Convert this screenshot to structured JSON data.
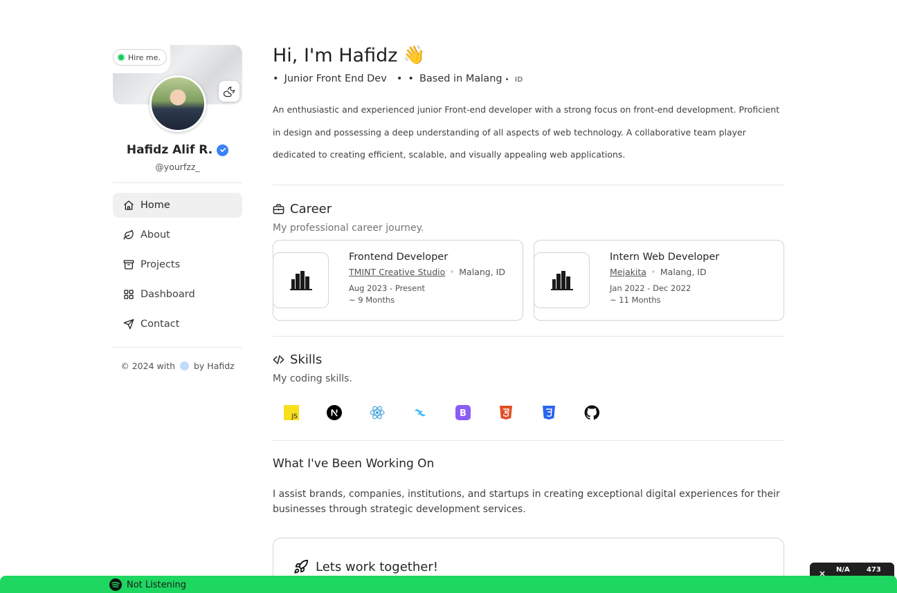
{
  "sidebar": {
    "hire_label": "Hire me.",
    "name": "Hafidz Alif R.",
    "handle": "@yourfzz_",
    "nav": [
      {
        "label": "Home",
        "icon": "home-icon",
        "active": true
      },
      {
        "label": "About",
        "icon": "leaf-icon",
        "active": false
      },
      {
        "label": "Projects",
        "icon": "archive-icon",
        "active": false
      },
      {
        "label": "Dashboard",
        "icon": "dashboard-icon",
        "active": false
      },
      {
        "label": "Contact",
        "icon": "send-icon",
        "active": false
      }
    ],
    "credit_prefix": "© 2024 with",
    "credit_suffix": "by Hafidz"
  },
  "hero": {
    "greeting": "Hi, I'm Hafidz",
    "wave_emoji": "👋",
    "role": "Junior Front End Dev",
    "location": "Based in Malang",
    "location_tag": "ID",
    "intro": "An enthusiastic and experienced junior Front-end developer with a strong focus on front-end development. Proficient in design and possessing a deep understanding of all aspects of web technology. A collaborative team player dedicated to creating efficient, scalable, and visually appealing web applications."
  },
  "career": {
    "title": "Career",
    "subtitle": "My professional career journey.",
    "jobs": [
      {
        "title": "Frontend Developer",
        "company": "TMINT Creative Studio",
        "location": "Malang, ID",
        "dates": "Aug 2023 - Present",
        "duration": "~ 9 Months"
      },
      {
        "title": "Intern Web Developer",
        "company": "Mejakita",
        "location": "Malang, ID",
        "dates": "Jan 2022 - Dec 2022",
        "duration": "~ 11 Months"
      }
    ]
  },
  "skills": {
    "title": "Skills",
    "subtitle": "My coding skills.",
    "icons": [
      "javascript-icon",
      "nextjs-icon",
      "react-icon",
      "tailwind-icon",
      "bootstrap-icon",
      "html5-icon",
      "css3-icon",
      "github-icon"
    ]
  },
  "work": {
    "title": "What I've Been Working On",
    "text": "I assist brands, companies, institutions, and startups in creating exceptional digital experiences for their businesses through strategic development services.",
    "cta_title": "Lets work together!"
  },
  "spotify": {
    "status": "Not Listening"
  },
  "widget": {
    "close": "×",
    "label": "N/A",
    "count": "473"
  },
  "colors": {
    "accent_green": "#1ed760",
    "verified_blue": "#3b82f6",
    "hire_dot": "#22c55e"
  }
}
